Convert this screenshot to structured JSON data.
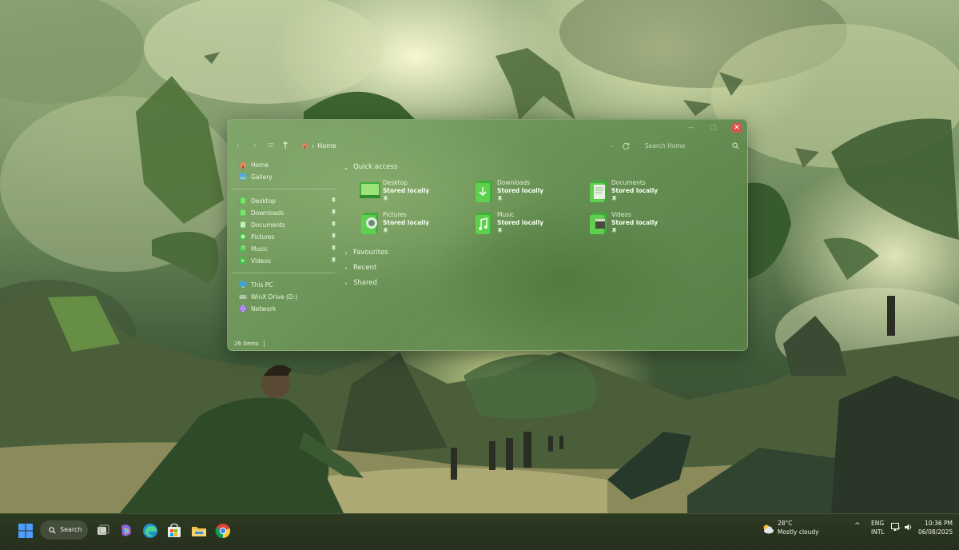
{
  "window": {
    "controls": {
      "minimize": "—",
      "maximize": "□",
      "close": "✕"
    },
    "toolbar": {
      "back": "‹",
      "forward": "›",
      "recent": "≡",
      "up": "↑",
      "breadcrumb_sep": "›",
      "breadcrumb": "Home",
      "search_placeholder": "Search Home",
      "dropdown": "⌄"
    },
    "sidebar": {
      "top": [
        {
          "label": "Home",
          "icon": "home-icon"
        },
        {
          "label": "Gallery",
          "icon": "gallery-icon"
        }
      ],
      "pinned": [
        {
          "label": "Desktop",
          "icon": "desktop-icon"
        },
        {
          "label": "Downloads",
          "icon": "downloads-icon"
        },
        {
          "label": "Documents",
          "icon": "documents-icon"
        },
        {
          "label": "Pictures",
          "icon": "pictures-icon"
        },
        {
          "label": "Music",
          "icon": "music-icon"
        },
        {
          "label": "Videos",
          "icon": "videos-icon"
        }
      ],
      "devices": [
        {
          "label": "This PC",
          "icon": "this-pc-icon"
        },
        {
          "label": "WinX Drive (D:)",
          "icon": "drive-icon"
        },
        {
          "label": "Network",
          "icon": "network-icon"
        }
      ]
    },
    "main": {
      "quick_access": {
        "label": "Quick access",
        "chevron": "⌄",
        "items": [
          {
            "name": "Desktop",
            "status": "Stored locally"
          },
          {
            "name": "Downloads",
            "status": "Stored locally"
          },
          {
            "name": "Documents",
            "status": "Stored locally"
          },
          {
            "name": "Pictures",
            "status": "Stored locally"
          },
          {
            "name": "Music",
            "status": "Stored locally"
          },
          {
            "name": "Videos",
            "status": "Stored locally"
          }
        ]
      },
      "sections": [
        {
          "label": "Favourites",
          "chevron": "›"
        },
        {
          "label": "Recent",
          "chevron": "›"
        },
        {
          "label": "Shared",
          "chevron": "›"
        }
      ]
    },
    "status": {
      "item_count": "26 items"
    }
  },
  "taskbar": {
    "search_label": "Search",
    "weather": {
      "temp": "28°C",
      "condition": "Mostly cloudy"
    },
    "tray": {
      "chevron": "^",
      "lang_top": "ENG",
      "lang_bottom": "INTL",
      "time": "10:36 PM",
      "date": "06/08/2025"
    },
    "accent": "#4f9bff"
  }
}
